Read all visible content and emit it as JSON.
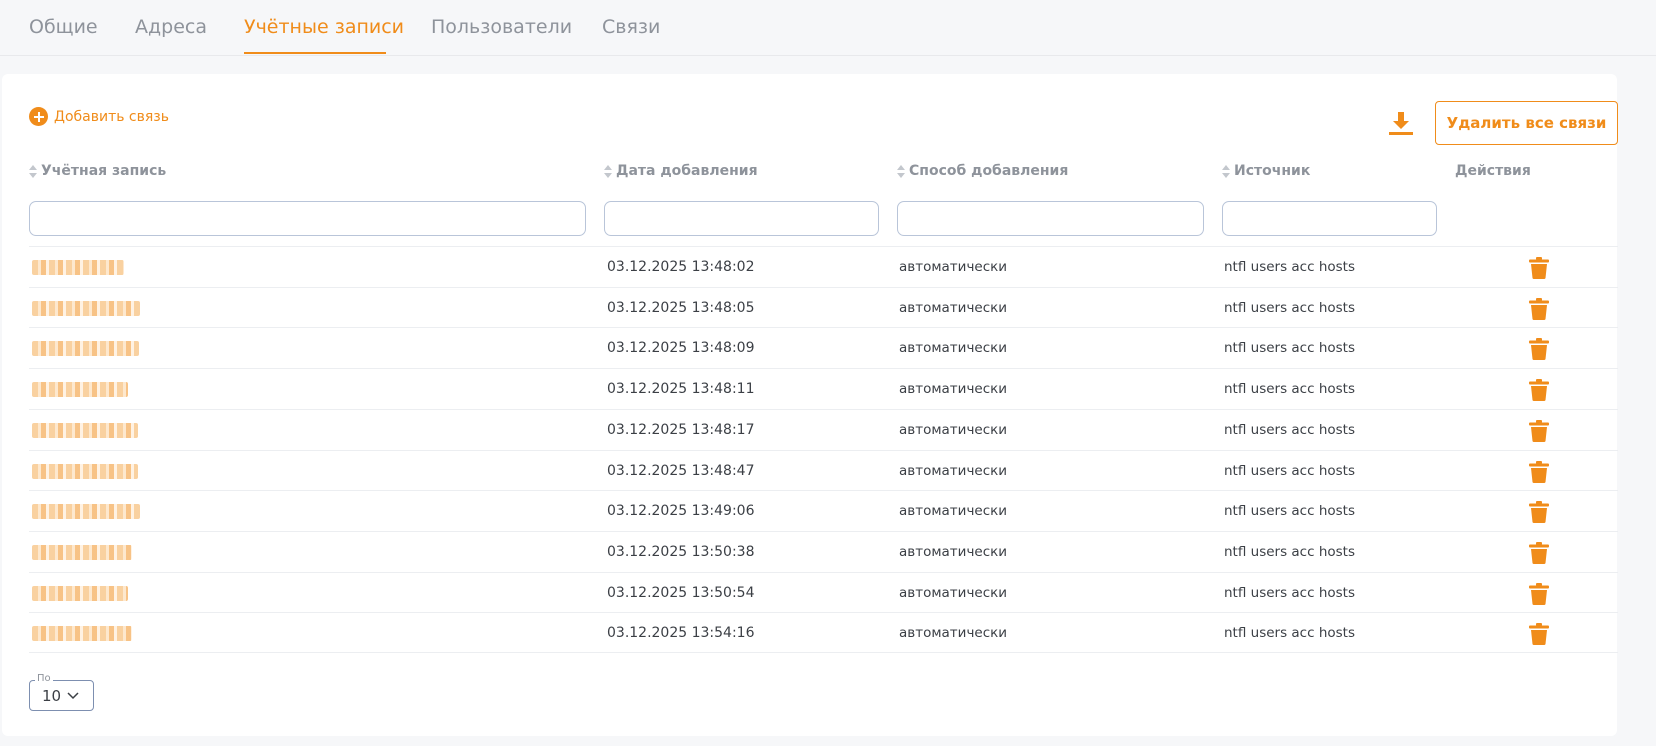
{
  "tabs": [
    {
      "label": "Общие"
    },
    {
      "label": "Адреса"
    },
    {
      "label": "Учётные записи"
    },
    {
      "label": "Пользователи"
    },
    {
      "label": "Связи"
    }
  ],
  "active_tab": "Учётные записи",
  "toolbar": {
    "add_label": "Добавить связь",
    "delete_all_label": "Удалить все связи",
    "download_icon": "download-icon"
  },
  "table": {
    "headers": {
      "account": "Учётная запись",
      "date": "Дата добавления",
      "method": "Способ добавления",
      "source": "Источник",
      "actions": "Действия"
    },
    "rows": [
      {
        "date": "03.12.2025 13:48:02",
        "method": "автоматически",
        "source": "ntfl users acc hosts"
      },
      {
        "date": "03.12.2025 13:48:05",
        "method": "автоматически",
        "source": "ntfl users acc hosts"
      },
      {
        "date": "03.12.2025 13:48:09",
        "method": "автоматически",
        "source": "ntfl users acc hosts"
      },
      {
        "date": "03.12.2025 13:48:11",
        "method": "автоматически",
        "source": "ntfl users acc hosts"
      },
      {
        "date": "03.12.2025 13:48:17",
        "method": "автоматически",
        "source": "ntfl users acc hosts"
      },
      {
        "date": "03.12.2025 13:48:47",
        "method": "автоматически",
        "source": "ntfl users acc hosts"
      },
      {
        "date": "03.12.2025 13:49:06",
        "method": "автоматически",
        "source": "ntfl users acc hosts"
      },
      {
        "date": "03.12.2025 13:50:38",
        "method": "автоматически",
        "source": "ntfl users acc hosts"
      },
      {
        "date": "03.12.2025 13:50:54",
        "method": "автоматически",
        "source": "ntfl users acc hosts"
      },
      {
        "date": "03.12.2025 13:54:16",
        "method": "автоматически",
        "source": "ntfl users acc hosts"
      }
    ]
  },
  "pagination": {
    "per_page_label": "По",
    "per_page_value": "10"
  },
  "colors": {
    "accent": "#f08c1a",
    "muted": "#8e939b"
  }
}
